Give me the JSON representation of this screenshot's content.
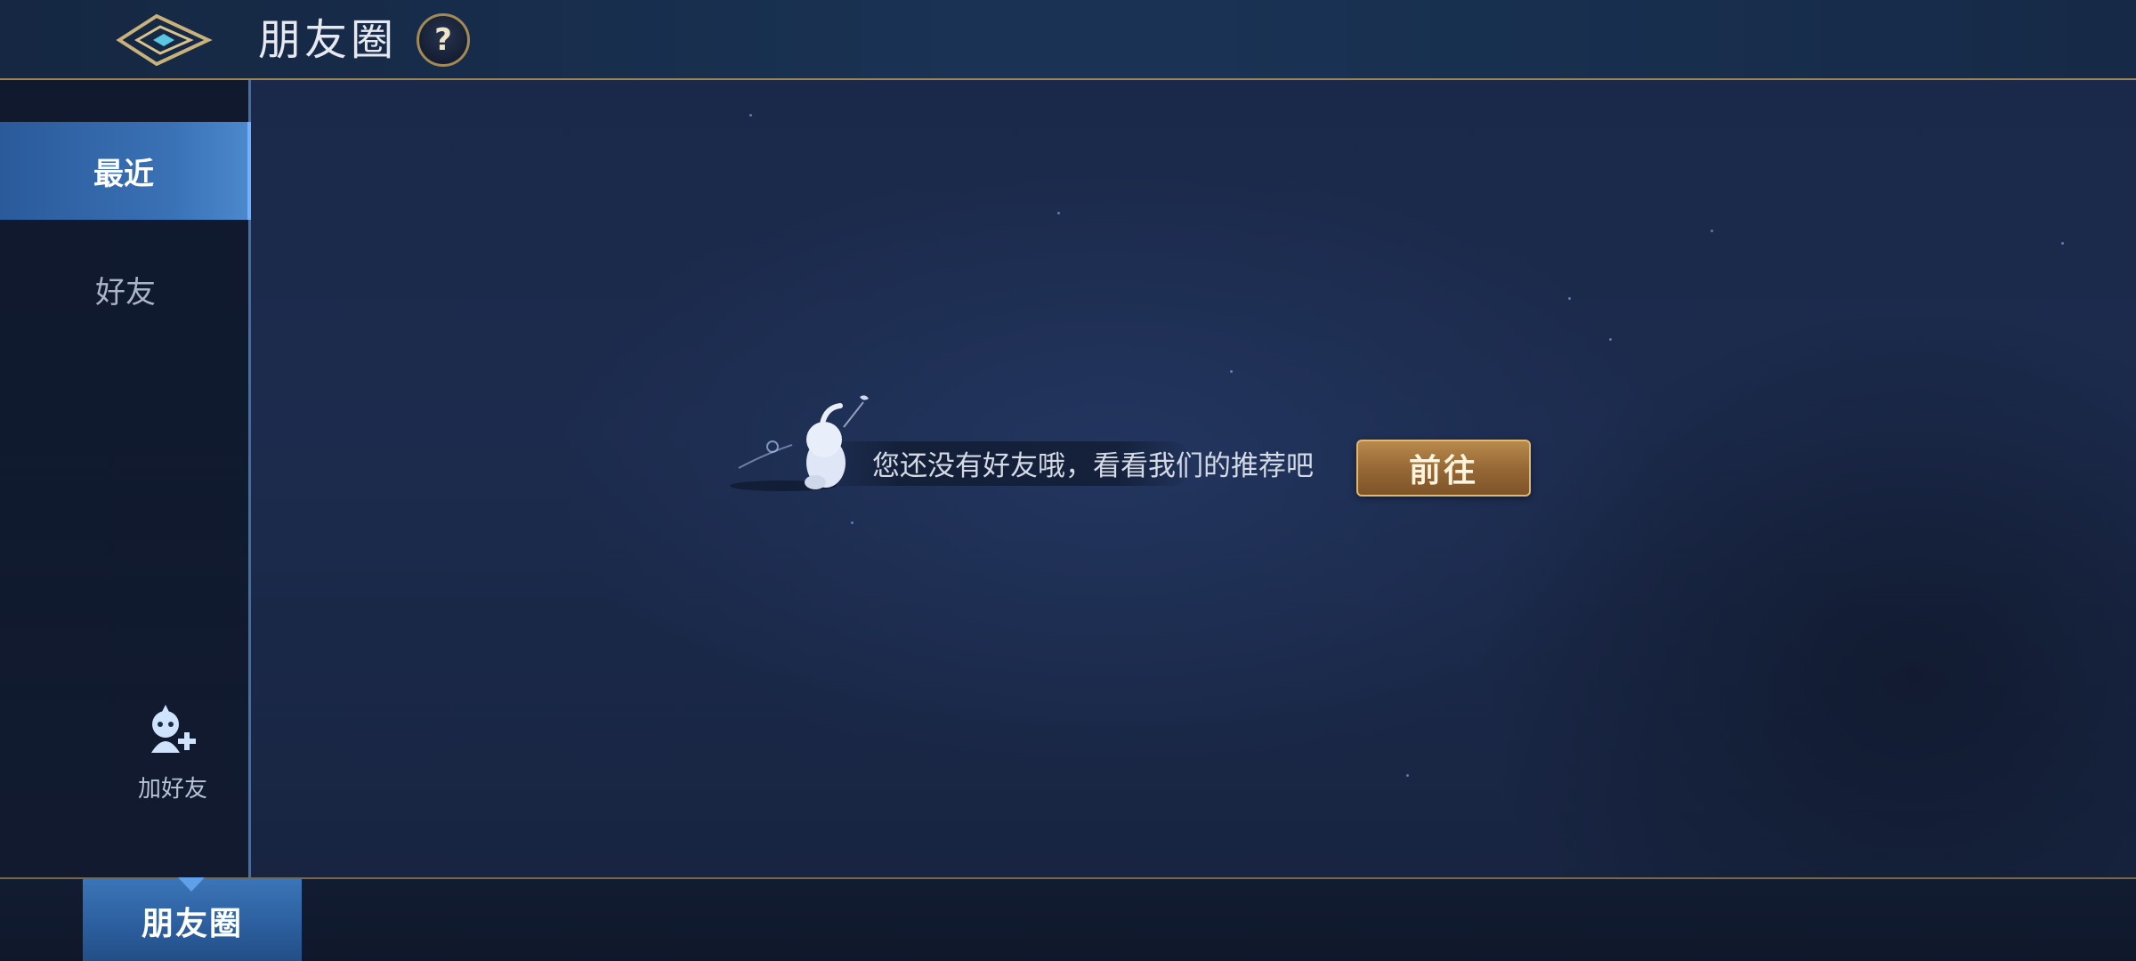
{
  "header": {
    "title": "朋友圈",
    "help_label": "?"
  },
  "sidebar": {
    "items": [
      {
        "label": "最近",
        "active": true
      },
      {
        "label": "好友",
        "active": false
      }
    ],
    "add_friend_label": "加好友"
  },
  "main": {
    "empty_message": "您还没有好友哦，看看我们的推荐吧",
    "goto_label": "前往"
  },
  "bottom_tabs": [
    {
      "label": "朋友圈",
      "active": true
    }
  ],
  "icons": {
    "back": "back-arrow-icon",
    "help": "help-icon",
    "add_friend": "add-friend-icon",
    "mascot": "mascot-illustration"
  },
  "colors": {
    "accent_gold": "#a38a55",
    "accent_blue": "#3a72b6",
    "button_gold": "#946634"
  }
}
